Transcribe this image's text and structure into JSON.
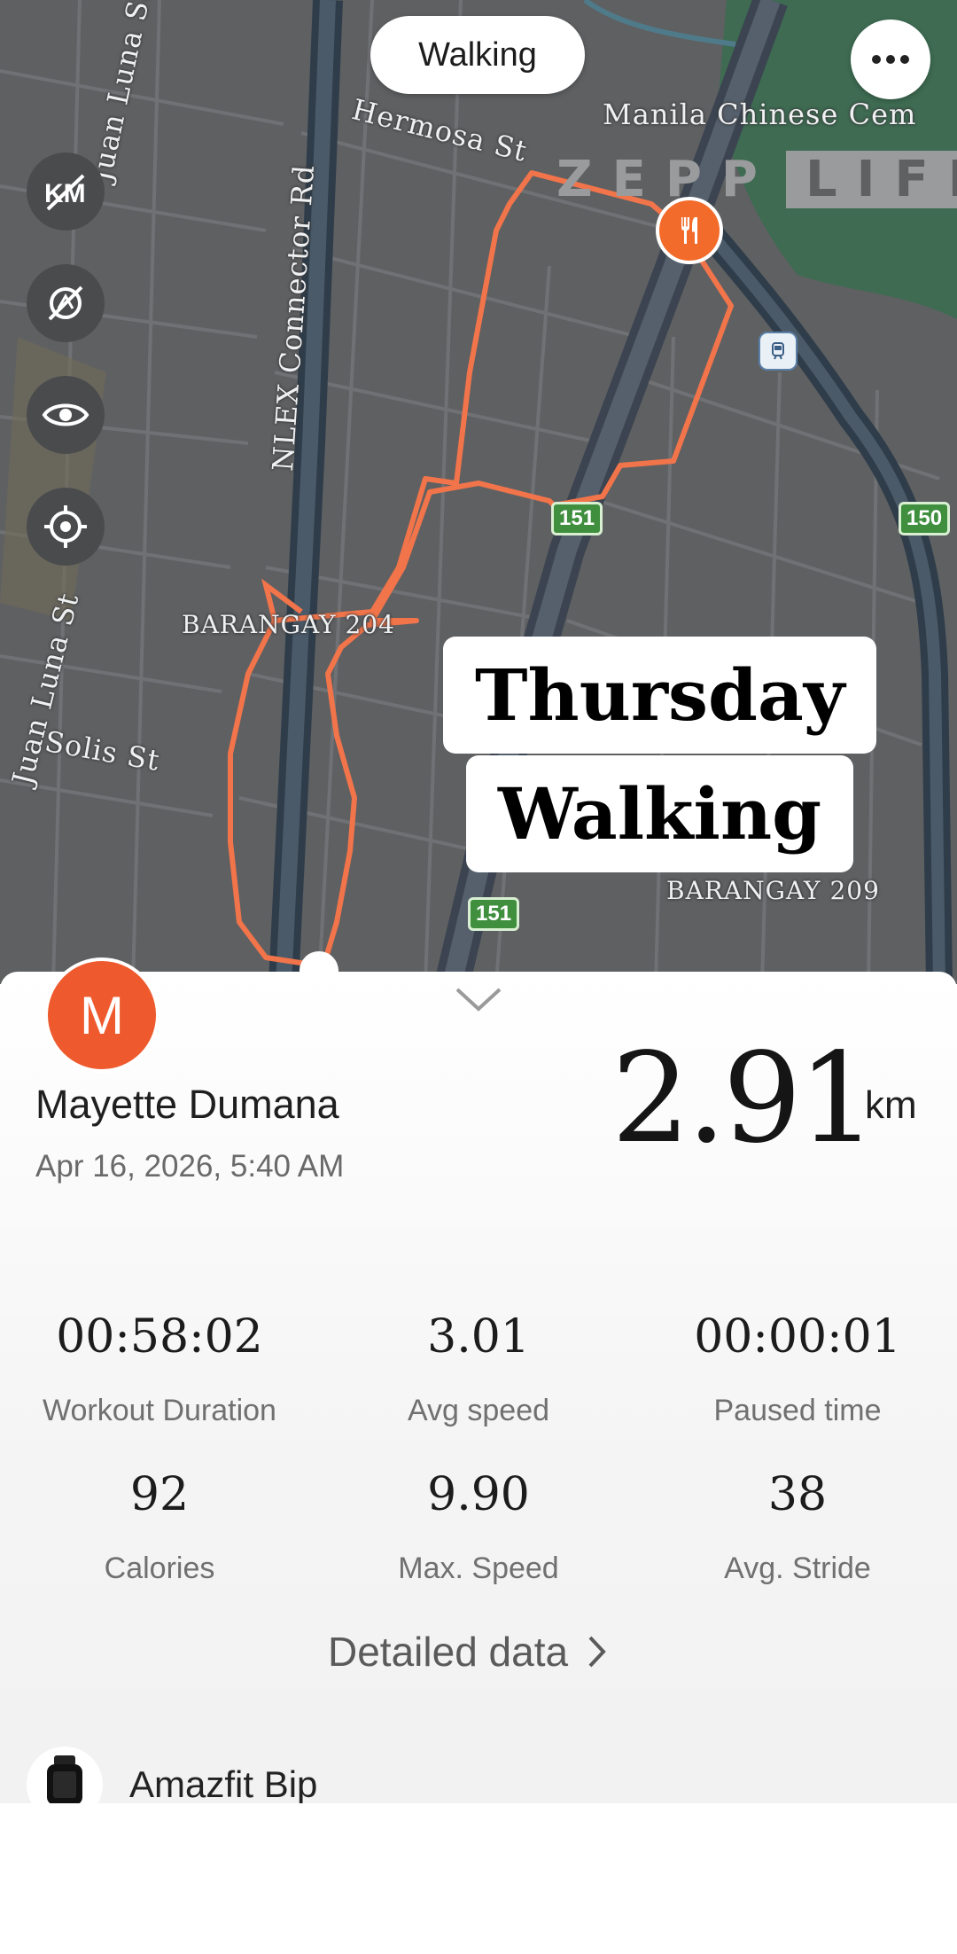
{
  "header": {
    "mode_label": "Walking"
  },
  "map": {
    "streets": [
      "Juan Luna St",
      "Hermosa St",
      "NLEX Connector Rd",
      "Manila Chinese Cem",
      "Solis St",
      "Juan Luna St"
    ],
    "barangays": [
      "BARANGAY 204",
      "BARANGAY 209"
    ],
    "route_shields": [
      "151",
      "150",
      "151"
    ],
    "watermark": {
      "left": "ZEPP",
      "right": "LIFE"
    },
    "caption": {
      "line1": "Thursday",
      "line2": "Walking"
    },
    "route_color": "#f2744a",
    "side_controls": [
      "hide-distance-icon",
      "hide-pace-icon",
      "eye-icon",
      "locate-icon"
    ]
  },
  "summary": {
    "avatar_letter": "M",
    "user_name": "Mayette Dumana",
    "datetime": "Apr 16, 2026, 5:40 AM",
    "distance": "2.91",
    "distance_unit": "km"
  },
  "stats": [
    {
      "value": "00:58:02",
      "label": "Workout Duration"
    },
    {
      "value": "3.01",
      "label": "Avg speed"
    },
    {
      "value": "00:00:01",
      "label": "Paused time"
    },
    {
      "value": "92",
      "label": "Calories"
    },
    {
      "value": "9.90",
      "label": "Max. Speed"
    },
    {
      "value": "38",
      "label": "Avg. Stride"
    }
  ],
  "detail_link": "Detailed data",
  "device": {
    "name": "Amazfit Bip"
  },
  "colors": {
    "accent": "#ee5a2d",
    "map_bg": "#5f6062",
    "park": "#3e6b52"
  }
}
